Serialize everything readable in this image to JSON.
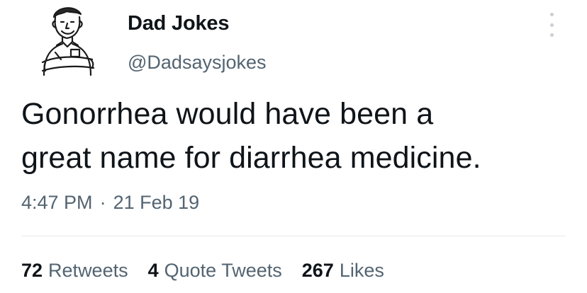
{
  "tweet": {
    "display_name": "Dad Jokes",
    "handle": "@Dadsaysjokes",
    "text_line1": "Gonorrhea would have been a",
    "text_line2": "great name for diarrhea medicine.",
    "time": "4:47 PM",
    "separator": "·",
    "date": "21 Feb 19",
    "avatar_icon": "cartoon-dad-avatar-icon",
    "more_icon": "vertical-ellipsis-icon"
  },
  "stats": {
    "retweets_count": "72",
    "retweets_label": "Retweets",
    "quotes_count": "4",
    "quotes_label": "Quote Tweets",
    "likes_count": "267",
    "likes_label": "Likes"
  },
  "colors": {
    "text_primary": "#0f1419",
    "text_secondary": "#536471",
    "divider": "#e6e9eb",
    "background": "#ffffff"
  }
}
